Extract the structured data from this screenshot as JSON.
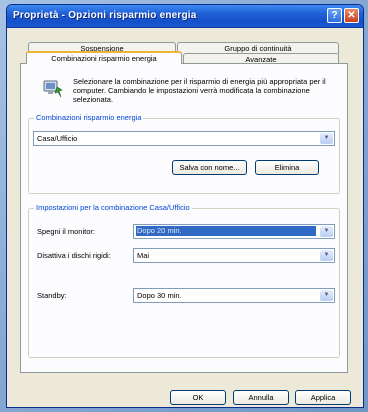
{
  "window": {
    "title": "Proprietà - Opzioni risparmio energia",
    "help_glyph": "?",
    "close_glyph": "✕"
  },
  "tabs": {
    "back_row": [
      "Sospensione",
      "Gruppo di continuità"
    ],
    "front_row": [
      "Combinazioni risparmio energia",
      "Avanzate"
    ],
    "selected": "Combinazioni risparmio energia"
  },
  "intro": {
    "text": "Selezionare la combinazione per il risparmio di energia più appropriata per il computer. Cambiando le impostazioni verrà modificata la combinazione selezionata.",
    "icon": "power-scheme-icon"
  },
  "schemes": {
    "legend": "Combinazioni risparmio energia",
    "selected": "Casa/Ufficio",
    "save_as_label": "Salva con nome...",
    "delete_label": "Elimina"
  },
  "settings": {
    "legend": "Impostazioni per la combinazione Casa/Ufficio",
    "rows": [
      {
        "label": "Spegni il monitor:",
        "value": "Dopo 20 min."
      },
      {
        "label": "Disattiva i dischi rigidi:",
        "value": "Mai"
      },
      {
        "label": "Standby:",
        "value": "Dopo 30 min."
      }
    ]
  },
  "footer": {
    "ok_label": "OK",
    "cancel_label": "Annulla",
    "apply_label": "Applica"
  }
}
